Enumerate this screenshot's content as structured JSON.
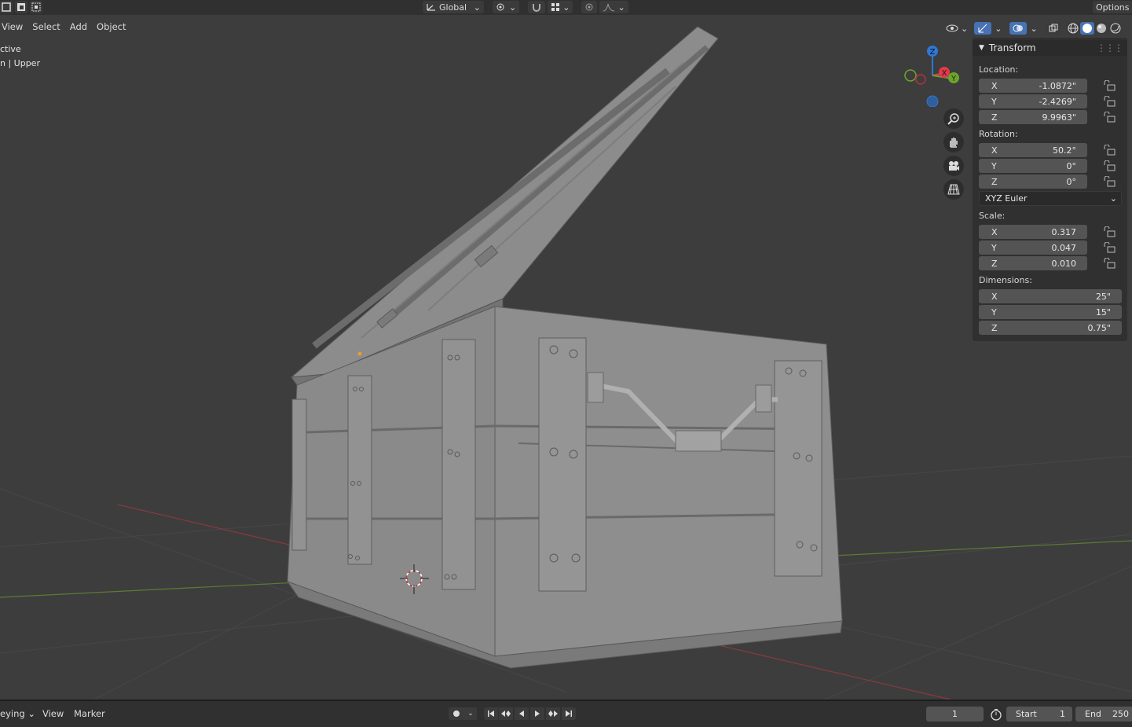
{
  "header": {
    "transform_orientation": "Global",
    "menus": [
      "View",
      "Select",
      "Add",
      "Object"
    ],
    "options_label": "Options"
  },
  "viewport": {
    "info_line1": "ctive",
    "info_line2": "n | Upper"
  },
  "gizmo": {
    "z_label": "Z",
    "x_label": "X",
    "y_label": "Y",
    "colors": {
      "x": "#e03b4a",
      "y": "#6ea42c",
      "z": "#2f78d4"
    }
  },
  "npanel": {
    "title": "Transform",
    "location": {
      "label": "Location:",
      "axes": [
        {
          "axis": "X",
          "value": "-1.0872\""
        },
        {
          "axis": "Y",
          "value": "-2.4269\""
        },
        {
          "axis": "Z",
          "value": "9.9963\""
        }
      ]
    },
    "rotation": {
      "label": "Rotation:",
      "axes": [
        {
          "axis": "X",
          "value": "50.2°"
        },
        {
          "axis": "Y",
          "value": "0°"
        },
        {
          "axis": "Z",
          "value": "0°"
        }
      ],
      "mode": "XYZ Euler"
    },
    "scale": {
      "label": "Scale:",
      "axes": [
        {
          "axis": "X",
          "value": "0.317"
        },
        {
          "axis": "Y",
          "value": "0.047"
        },
        {
          "axis": "Z",
          "value": "0.010"
        }
      ]
    },
    "dimensions": {
      "label": "Dimensions:",
      "axes": [
        {
          "axis": "X",
          "value": "25\""
        },
        {
          "axis": "Y",
          "value": "15\""
        },
        {
          "axis": "Z",
          "value": "0.75\""
        }
      ]
    }
  },
  "timeline": {
    "keying_label": "eying",
    "view_label": "View",
    "marker_label": "Marker",
    "current_frame": "1",
    "start_label": "Start",
    "start_value": "1",
    "end_label": "End",
    "end_value": "250"
  }
}
